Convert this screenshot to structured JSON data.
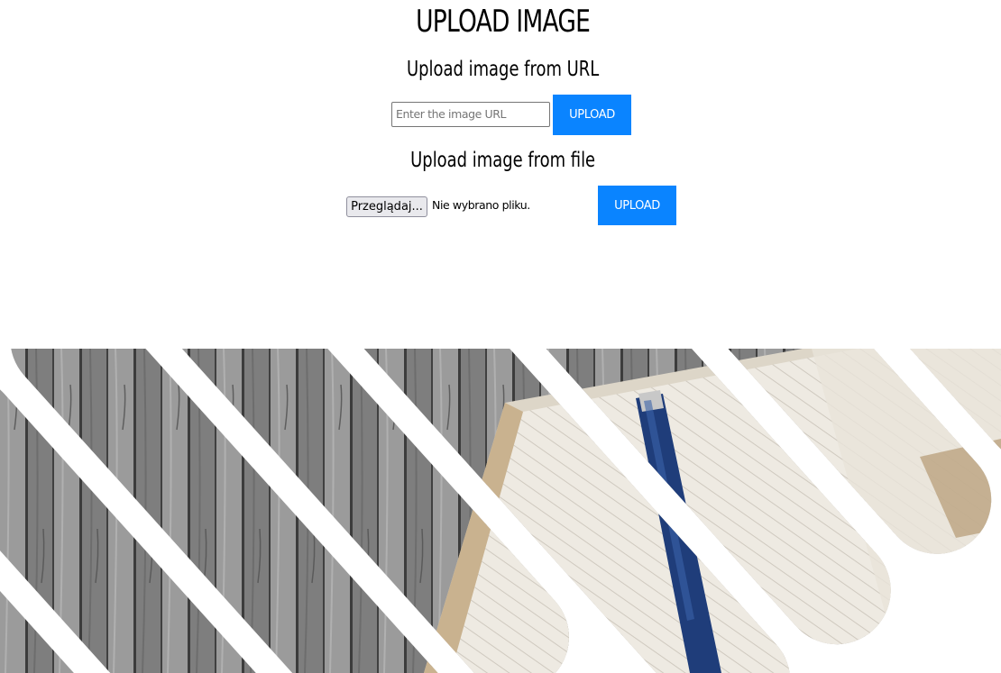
{
  "header": {
    "title": "UPLOAD IMAGE"
  },
  "url_upload": {
    "heading": "Upload image from URL",
    "input_placeholder": "Enter the image URL",
    "input_value": "",
    "button_label": "UPLOAD"
  },
  "file_upload": {
    "heading": "Upload image from file",
    "browse_label": "Przeglądaj...",
    "status_text": "Nie wybrano pliku.",
    "button_label": "UPLOAD"
  },
  "colors": {
    "button_bg": "#0a84ff",
    "button_text": "#ffffff"
  },
  "decoration": {
    "icon": "diagonal-striped-desk-photo"
  }
}
